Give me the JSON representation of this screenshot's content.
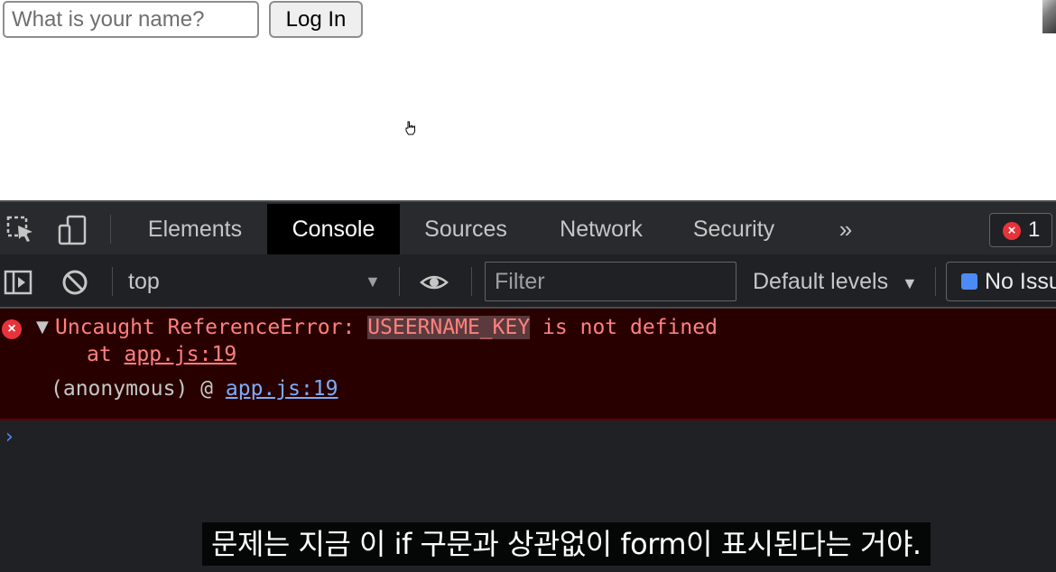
{
  "page": {
    "name_input_placeholder": "What is your name?",
    "login_button_label": "Log In"
  },
  "devtools": {
    "tabs": [
      {
        "label": "Elements",
        "active": false
      },
      {
        "label": "Console",
        "active": true
      },
      {
        "label": "Sources",
        "active": false
      },
      {
        "label": "Network",
        "active": false
      },
      {
        "label": "Security",
        "active": false
      }
    ],
    "more_tabs": "»",
    "error_count": "1",
    "toolbar": {
      "context": "top",
      "filter_placeholder": "Filter",
      "levels_label": "Default levels",
      "issues_label": "No Issues"
    },
    "console": {
      "error_prefix": "Uncaught ReferenceError: ",
      "error_highlight": "USEERNAME_KEY",
      "error_suffix": " is not defined",
      "at_text": "at ",
      "at_link": "app.js:19",
      "anon_text": "(anonymous) @ ",
      "anon_link": "app.js:19",
      "prompt_symbol": "›"
    },
    "colors": {
      "panel_bg": "#202124",
      "error_bg": "#290000",
      "error_text": "#ff8080",
      "link_blue": "#7cacf8",
      "error_badge": "#e8333a"
    }
  },
  "subtitle": "문제는 지금 이 if 구문과 상관없이 form이 표시된다는 거야."
}
